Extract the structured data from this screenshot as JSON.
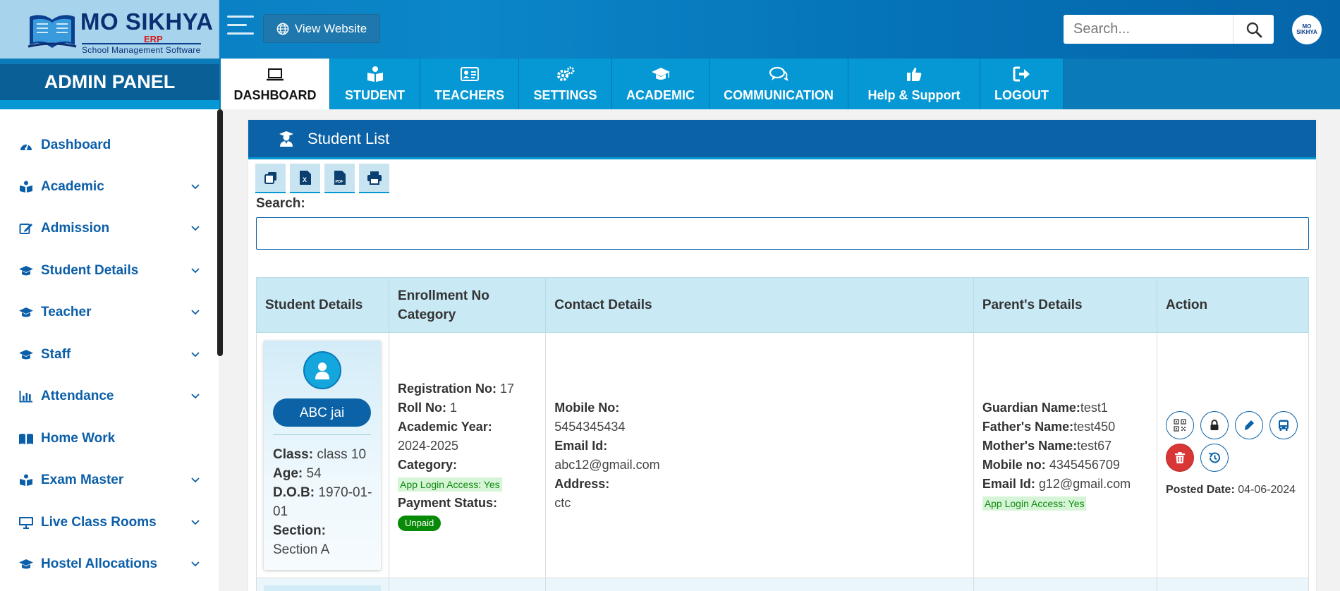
{
  "brand": {
    "name_part1": "MO ",
    "name_part2": "SIKHYA",
    "erp": "ERP",
    "tagline": "School Management Software"
  },
  "header": {
    "view_website_label": "View Website",
    "search_placeholder": "Search...",
    "avatar_text": "MO SIKHYA"
  },
  "nav": {
    "admin_panel": "ADMIN PANEL",
    "tabs": [
      {
        "label": "DASHBOARD",
        "icon": "laptop-icon",
        "active": true
      },
      {
        "label": "STUDENT",
        "icon": "book-reader-icon"
      },
      {
        "label": "TEACHERS",
        "icon": "id-card-icon"
      },
      {
        "label": "SETTINGS",
        "icon": "cogs-icon"
      },
      {
        "label": "ACADEMIC",
        "icon": "graduation-cap-icon"
      },
      {
        "label": "COMMUNICATION",
        "icon": "chat-bubbles-icon"
      },
      {
        "label": "Help & Support",
        "icon": "thumbs-up-icon"
      },
      {
        "label": "LOGOUT",
        "icon": "sign-out-icon"
      }
    ]
  },
  "sidebar": {
    "items": [
      {
        "label": "Dashboard",
        "icon": "gauge-icon",
        "has_children": false
      },
      {
        "label": "Academic",
        "icon": "book-reader-icon",
        "has_children": true
      },
      {
        "label": "Admission",
        "icon": "edit-icon",
        "has_children": true
      },
      {
        "label": "Student Details",
        "icon": "graduation-cap-icon",
        "has_children": true
      },
      {
        "label": "Teacher",
        "icon": "graduation-cap-icon",
        "has_children": true
      },
      {
        "label": "Staff",
        "icon": "graduation-cap-icon",
        "has_children": true
      },
      {
        "label": "Attendance",
        "icon": "bar-chart-icon",
        "has_children": true
      },
      {
        "label": "Home Work",
        "icon": "open-book-icon",
        "has_children": false
      },
      {
        "label": "Exam Master",
        "icon": "book-reader-icon",
        "has_children": true
      },
      {
        "label": "Live Class Rooms",
        "icon": "desktop-icon",
        "has_children": true
      },
      {
        "label": "Hostel Allocations",
        "icon": "graduation-cap-icon",
        "has_children": true
      }
    ]
  },
  "main": {
    "title": "Student List",
    "search_label": "Search:",
    "tools": [
      "copy-icon",
      "excel-icon",
      "pdf-icon",
      "print-icon"
    ],
    "tool_texts": {
      "excel": "X",
      "pdf": "PDF"
    },
    "columns": [
      "Student Details",
      "Enrollment No Category",
      "Contact Details",
      "Parent's Details",
      "Action"
    ],
    "rows": [
      {
        "student": {
          "name": "ABC jai",
          "class_label": "Class:",
          "class": "class 10",
          "age_label": "Age:",
          "age": "54",
          "dob_label": "D.O.B:",
          "dob": "1970-01-01",
          "section_label": "Section:",
          "section": "Section A"
        },
        "enrollment": {
          "reg_label": "Registration No:",
          "reg_no": "17",
          "roll_label": "Roll No:",
          "roll_no": "1",
          "year_label": "Academic Year:",
          "year": "2024-2025",
          "category_label": "Category:",
          "app_access": "App Login Access: Yes",
          "payment_label": "Payment Status:",
          "payment_status": "Unpaid"
        },
        "contact": {
          "mobile_label": "Mobile No:",
          "mobile": "5454345434",
          "email_label": "Email Id:",
          "email": "abc12@gmail.com",
          "address_label": "Address:",
          "address": "ctc"
        },
        "parent": {
          "guardian_label": "Guardian Name:",
          "guardian": "test1",
          "father_label": "Father's Name:",
          "father": "test450",
          "mother_label": "Mother's Name:",
          "mother": "test67",
          "mobile_label": "Mobile no:",
          "mobile": "4345456709",
          "email_label": "Email Id:",
          "email": "g12@gmail.com",
          "app_access": "App Login Access: Yes"
        },
        "action": {
          "posted_label": "Posted Date:",
          "posted_date": "04-06-2024",
          "buttons": [
            "qr-code-icon",
            "lock-icon",
            "pen-icon",
            "bus-icon",
            "trash-icon",
            "history-icon"
          ]
        }
      }
    ]
  },
  "colors": {
    "primary": "#0b62a6",
    "accent": "#0598d4",
    "header_cell": "#c9e9f4",
    "unpaid": "#078a07",
    "delete": "#d93636"
  }
}
